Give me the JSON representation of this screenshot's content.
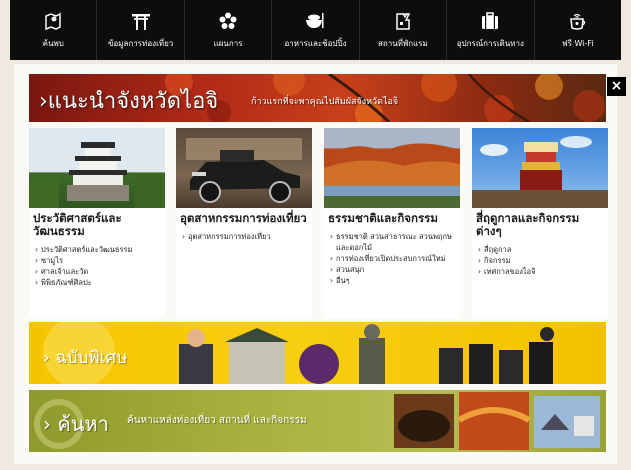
{
  "nav": {
    "items": [
      {
        "label": "ค้นพบ",
        "icon": "map-pin-icon"
      },
      {
        "label": "ข้อมูลการท่องเที่ยว",
        "icon": "torii-gate-icon"
      },
      {
        "label": "แผนการ",
        "icon": "flower-icon"
      },
      {
        "label": "อาหารและช้อปปิ้ง",
        "icon": "rice-bowl-icon"
      },
      {
        "label": "สถานที่พักแรม",
        "icon": "hotel-icon"
      },
      {
        "label": "อุปกรณ์การเดินทาง",
        "icon": "luggage-icon"
      },
      {
        "label": "ฟรี Wi-Fi",
        "icon": "wifi-cup-icon"
      }
    ]
  },
  "close_label": "×",
  "banner": {
    "title": "›แนะนำจังหวัดไอจิ",
    "subtitle": "ก้าวแรกที่จะพาคุณไปสัมผัสจังหวัดไอจิ"
  },
  "cards": [
    {
      "title": "ประวัติศาสตร์และวัฒนธรรม",
      "links": [
        "ประวัติศาสตร์และวัฒนธรรม",
        "ซามูไร",
        "ศาลเจ้าและวัด",
        "พิพิธภัณฑ์ศิลปะ"
      ]
    },
    {
      "title": "อุตสาหกรรมการท่องเที่ยว",
      "links": [
        "อุตสาหกรรมการท่องเที่ยว"
      ]
    },
    {
      "title": "ธรรมชาติและกิจกรรม",
      "links": [
        "ธรรมชาติ สวนสาธารณะ สวนพฤกษ และดอกไม้",
        "การท่องเที่ยวเปิดประสบการณ์ใหม่",
        "สวนสนุก",
        "อื่นๆ"
      ]
    },
    {
      "title": "สี่ฤดูกาลและกิจกรรมต่างๆ",
      "links": [
        "สี่ฤดูกาล",
        "กิจกรรม",
        "เทศกาลของไอจิ"
      ]
    }
  ],
  "promo_special": {
    "title": "› ฉบับพิเศษ"
  },
  "promo_search": {
    "title": "› ค้นหา",
    "subtitle": "ค้นหาแหล่งท่องเที่ยว สถานที่ และกิจกรรม"
  },
  "colors": {
    "nav_bg": "#0d0d0d",
    "banner_red": "#b02a16",
    "promo_yellow": "#f5c400",
    "promo_olive": "#a9b23e"
  }
}
